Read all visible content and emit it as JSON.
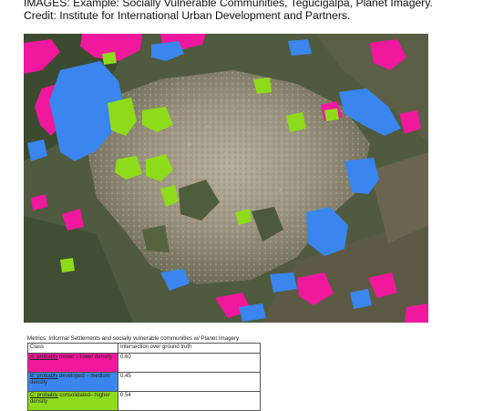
{
  "caption": {
    "line1": "IMAGES: Example: Socially Vulnerable Communities, Tegucigalpa, Planet Imagery.",
    "line2": "Credit: Institute for International Urban Development and Partners."
  },
  "map": {
    "colors": {
      "class_a": "#f0189c",
      "class_b": "#3a86ee",
      "class_c": "#8edb1c",
      "urban": "#9c9481",
      "vegetation": "#3f4d33"
    }
  },
  "metrics": {
    "title": "Metrics: Informal Settlements and socially vulnerable communities w/ Planet Imagery",
    "headers": [
      "Class",
      "Intersection over ground truth"
    ],
    "rows": [
      {
        "prefix": "A: probably",
        "rest": " newer – lower density",
        "value": "0.60",
        "color": "#f0189c"
      },
      {
        "prefix": "B: probably",
        "rest": " developed – medium density",
        "value": "0.45",
        "color": "#3a86ee"
      },
      {
        "prefix": "C: probably",
        "rest": " consolidated– higher density",
        "value": "0.54",
        "color": "#8edb1c"
      }
    ]
  }
}
